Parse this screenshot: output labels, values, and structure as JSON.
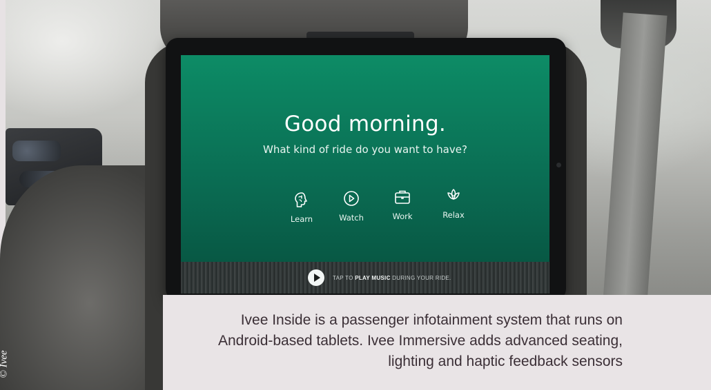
{
  "screen": {
    "greeting": "Good morning.",
    "question": "What kind of ride do you want to have?",
    "modes": [
      {
        "label": "Learn",
        "icon": "brain-icon"
      },
      {
        "label": "Watch",
        "icon": "play-circle-icon"
      },
      {
        "label": "Work",
        "icon": "briefcase-icon"
      },
      {
        "label": "Relax",
        "icon": "lotus-icon"
      }
    ],
    "music": {
      "prefix": "TAP TO ",
      "emphasis": "PLAY MUSIC",
      "suffix": " DURING YOUR RIDE."
    },
    "accent_color": "#0d8c66"
  },
  "caption": "Ivee Inside is a passenger infotainment system that runs on Android-based tablets. Ivee Immersive adds advanced seating, lighting and haptic feedback sensors",
  "credit": "© Ivee"
}
